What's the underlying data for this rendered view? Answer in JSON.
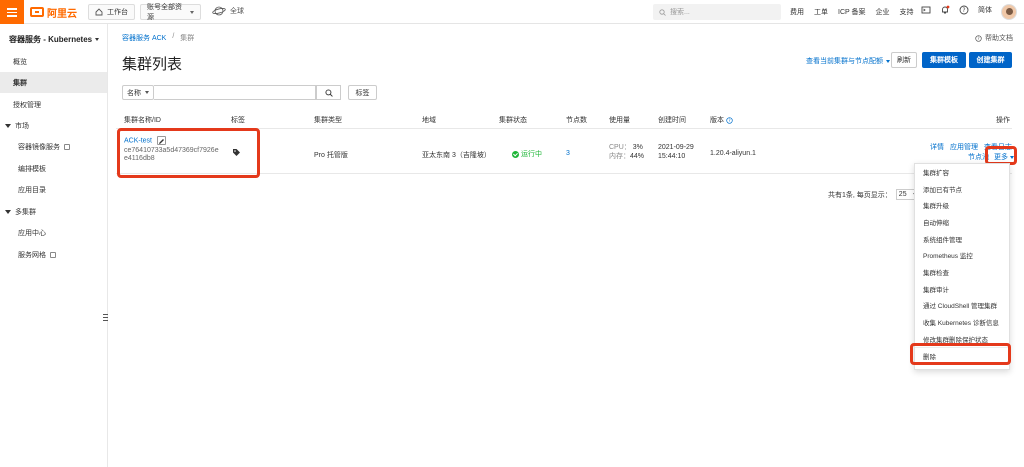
{
  "header": {
    "brand": "阿里云",
    "workbench": "工作台",
    "account_scope": "账号全部资源",
    "region": "全球",
    "search_placeholder": "搜索...",
    "links": [
      "费用",
      "工单",
      "ICP 备案",
      "企业",
      "支持"
    ],
    "lang": "简体"
  },
  "sidebar": {
    "title": "容器服务 - Kubernetes",
    "items": [
      {
        "label": "概览"
      },
      {
        "label": "集群"
      },
      {
        "label": "授权管理"
      }
    ],
    "group_market": "市场",
    "market_items": [
      "容器镜像服务",
      "编排模板",
      "应用目录"
    ],
    "group_multi": "多集群",
    "multi_items": [
      "应用中心",
      "服务网格"
    ]
  },
  "breadcrumb": {
    "root": "容器服务 ACK",
    "sep": "/",
    "current": "集群"
  },
  "help_doc": "帮助文档",
  "page_title": "集群列表",
  "toolbar": {
    "view_link": "查看当前集群与节点配额",
    "refresh": "刷新",
    "template": "集群模板",
    "create": "创建集群"
  },
  "filter": {
    "field": "名称",
    "tag_btn": "标签"
  },
  "table": {
    "headers": [
      "集群名称/ID",
      "标签",
      "集群类型",
      "地域",
      "集群状态",
      "节点数",
      "使用量",
      "创建时间",
      "版本",
      "操作"
    ],
    "rows": [
      {
        "name": "ACK-test",
        "id_line1": "ce76410733a5d47369cf7926e",
        "id_line2": "e4116db8",
        "type": "Pro 托管版",
        "region": "亚太东南 3（吉隆坡）",
        "status": "运行中",
        "nodes": "3",
        "cpu_label": "CPU：",
        "cpu": "3%",
        "mem_label": "内存：",
        "mem": "44%",
        "created_date": "2021-09-29",
        "created_time": "15:44:10",
        "version": "1.20.4-aliyun.1",
        "actions": [
          "详情",
          "应用管理",
          "查看日志"
        ],
        "action_nodes": "节点池",
        "more": "更多"
      }
    ]
  },
  "pager": {
    "text": "共有1条, 每页显示：",
    "size": "25"
  },
  "more_menu": [
    "集群扩容",
    "添加已有节点",
    "集群升级",
    "自动伸缩",
    "系统组件管理",
    "Prometheus 监控",
    "集群检查",
    "集群审计",
    "通过 CloudShell 管理集群",
    "收集 Kubernetes 诊断信息",
    "修改集群删除保护状态",
    "删除"
  ],
  "colors": {
    "brand": "#ff6a00",
    "primary": "#0064c8",
    "link": "#0070cc",
    "highlight": "#e4391b",
    "running": "#1db536"
  }
}
